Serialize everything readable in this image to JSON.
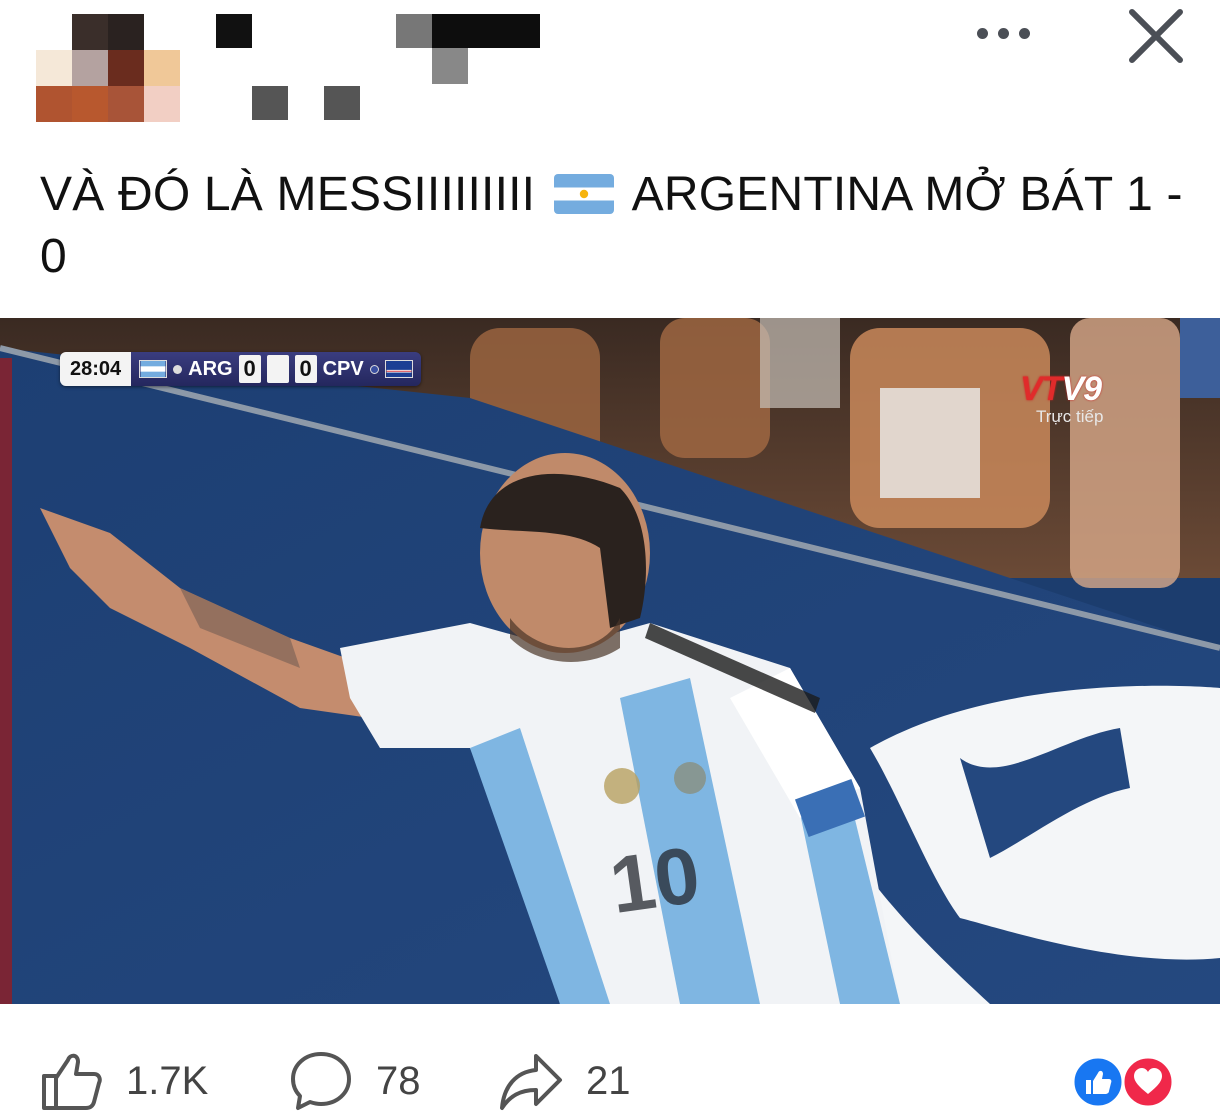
{
  "post": {
    "caption_part1": "VÀ ĐÓ LÀ MESSIIIIIIIII",
    "caption_part2": "ARGENTINA MỞ BÁT 1 - 0",
    "flag": "argentina-flag-emoji"
  },
  "header": {
    "more_icon": "more-horizontal-icon",
    "close_icon": "close-icon"
  },
  "broadcast": {
    "clock": "28:04",
    "home_team": "ARG",
    "home_score": "0",
    "away_team": "CPV",
    "away_score": "0",
    "channel": "VTV9",
    "channel_part1": "VT",
    "channel_part2": "V9",
    "live_label": "Trực tiếp"
  },
  "footer": {
    "likes": "1.7K",
    "comments": "78",
    "shares": "21",
    "like_icon": "thumbs-up-icon",
    "comment_icon": "comment-bubble-icon",
    "share_icon": "share-arrow-icon",
    "reaction_icons": [
      "like-reaction-icon",
      "love-reaction-icon"
    ]
  },
  "colors": {
    "facebook_blue": "#1877f2",
    "love_red": "#f0284a",
    "scorebug_bg": "#2b2e6b"
  }
}
